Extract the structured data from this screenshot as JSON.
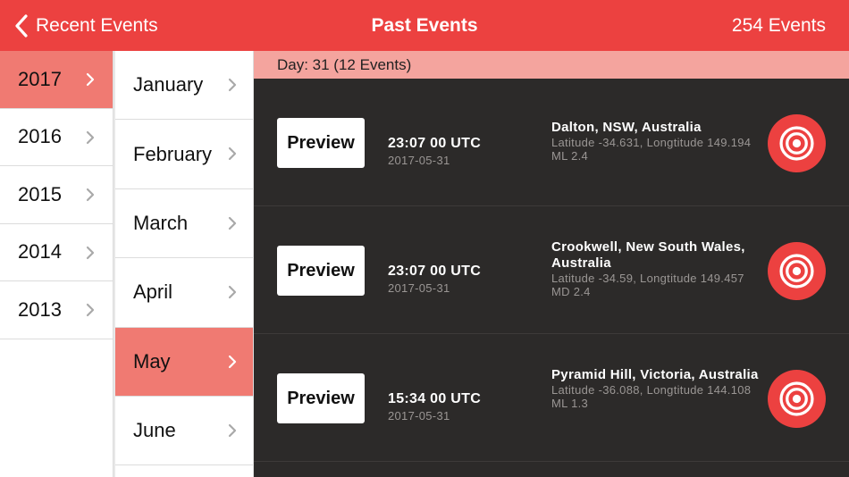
{
  "navbar": {
    "back_label": "Recent Events",
    "title": "Past Events",
    "count": "254 Events"
  },
  "years": [
    {
      "label": "2017",
      "selected": true
    },
    {
      "label": "2016",
      "selected": false
    },
    {
      "label": "2015",
      "selected": false
    },
    {
      "label": "2014",
      "selected": false
    },
    {
      "label": "2013",
      "selected": false
    }
  ],
  "months": [
    {
      "label": "January",
      "selected": false
    },
    {
      "label": "February",
      "selected": false
    },
    {
      "label": "March",
      "selected": false
    },
    {
      "label": "April",
      "selected": false
    },
    {
      "label": "May",
      "selected": true
    },
    {
      "label": "June",
      "selected": false
    }
  ],
  "day_header": "Day: 31 (12 Events)",
  "events": [
    {
      "preview_label": "Preview",
      "time": "23:07 00 UTC",
      "date": "2017-05-31",
      "place": "Dalton, NSW, Australia",
      "detail": "Latitude -34.631, Longtitude 149.194 ML 2.4"
    },
    {
      "preview_label": "Preview",
      "time": "23:07 00 UTC",
      "date": "2017-05-31",
      "place": "Crookwell, New South Wales, Australia",
      "detail": "Latitude -34.59, Longtitude 149.457 MD 2.4"
    },
    {
      "preview_label": "Preview",
      "time": "15:34 00 UTC",
      "date": "2017-05-31",
      "place": "Pyramid Hill, Victoria, Australia",
      "detail": "Latitude -36.088, Longtitude 144.108 ML 1.3"
    }
  ],
  "colors": {
    "accent": "#ec4140",
    "selected_row": "#f07a72",
    "day_header": "#f4a49e",
    "pane_bg": "#2c2a29"
  },
  "icons": {
    "back": "chevron-left-icon",
    "row": "chevron-right-icon",
    "event": "target-icon"
  }
}
